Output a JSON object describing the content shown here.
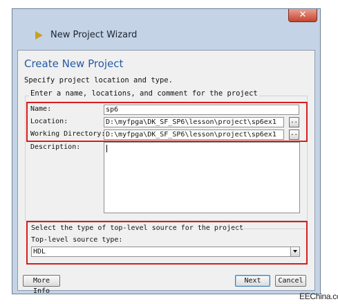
{
  "window": {
    "title": "New Project Wizard",
    "close_glyph": "✕"
  },
  "page": {
    "heading": "Create New Project",
    "subtitle": "Specify project location and type."
  },
  "project_group": {
    "caption": "Enter a name, locations, and comment for the project",
    "name_label": "Name:",
    "name_value": "sp6",
    "location_label": "Location:",
    "location_value": "D:\\myfpga\\DK_SF_SP6\\lesson\\project\\sp6ex1",
    "workdir_label": "Working Directory:",
    "workdir_value": "D:\\myfpga\\DK_SF_SP6\\lesson\\project\\sp6ex1",
    "browse_label": "..",
    "description_label": "Description:",
    "description_value": ""
  },
  "source_group": {
    "caption": "Select the type of top-level source for the project",
    "type_label": "Top-level source type:",
    "type_value": "HDL"
  },
  "buttons": {
    "more_info": "More Info",
    "next": "Next",
    "cancel": "Cancel"
  },
  "watermark": "EEChina.com",
  "colors": {
    "frame": "#c4d3e6",
    "heading": "#2459a8",
    "highlight": "#d81c1c"
  },
  "icons": {
    "title": "wizard-arrow-icon",
    "dropdown": "chevron-down-icon",
    "close": "close-icon"
  }
}
